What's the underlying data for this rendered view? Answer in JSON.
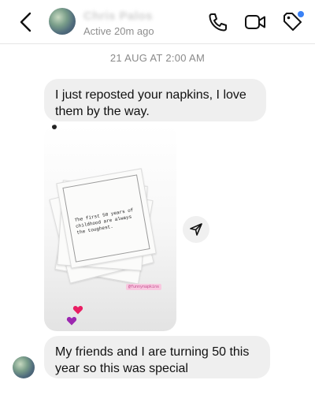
{
  "header": {
    "contact_name": "Chris Palos",
    "status": "Active 20m ago"
  },
  "thread": {
    "timestamp": "21 AUG AT 2:00 AM",
    "messages": [
      {
        "text": "I just reposted your napkins, I love them by the way."
      },
      {
        "text": "My friends and I are turning 50 this year so this was special"
      }
    ],
    "shared_post": {
      "napkin_text": "The first 50 years of childhood are always the toughest.",
      "handle": "@funnynapkins"
    }
  },
  "colors": {
    "bubble": "#efefef",
    "accent_dot": "#3b82f6",
    "heart_pink": "#e91e63",
    "heart_purple": "#9c27b0"
  }
}
